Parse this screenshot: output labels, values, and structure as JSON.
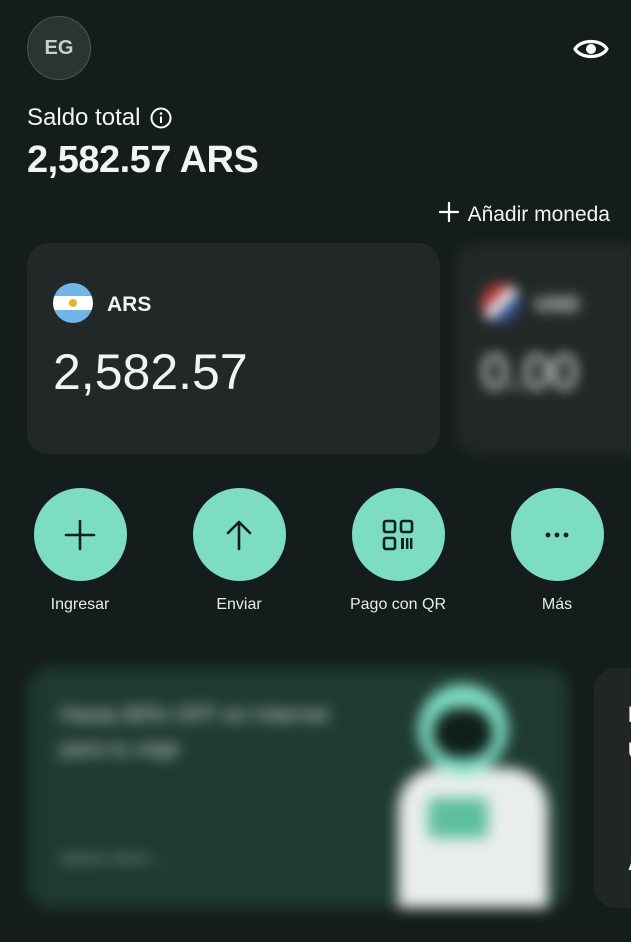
{
  "header": {
    "avatar_initials": "EG",
    "visibility_icon": "eye-icon"
  },
  "balance": {
    "label": "Saldo total",
    "info_icon": "info-icon",
    "total": "2,582.57 ARS"
  },
  "add_currency": {
    "icon": "plus-icon",
    "label": "Añadir moneda"
  },
  "accounts": [
    {
      "currency": "ARS",
      "amount": "2,582.57",
      "flag_icon": "argentina-flag-icon"
    },
    {
      "currency": "USD",
      "amount": "0.00",
      "flag_icon": "usa-flag-icon",
      "blurred": true
    }
  ],
  "actions": [
    {
      "label": "Ingresar",
      "icon": "plus-icon"
    },
    {
      "label": "Enviar",
      "icon": "arrow-up-icon"
    },
    {
      "label": "Pago con QR",
      "icon": "qr-code-icon"
    },
    {
      "label": "Más",
      "icon": "more-dots-icon"
    }
  ],
  "promo": {
    "text": "Hasta 80% OFF en Internet para tu viaje",
    "link": "Aplicar ahora →",
    "blurred": true
  },
  "promo_second": {
    "glyphs": [
      "I",
      "U",
      "A"
    ]
  },
  "colors": {
    "background": "#141d1b",
    "card": "#222827",
    "accent": "#7dddc2"
  }
}
